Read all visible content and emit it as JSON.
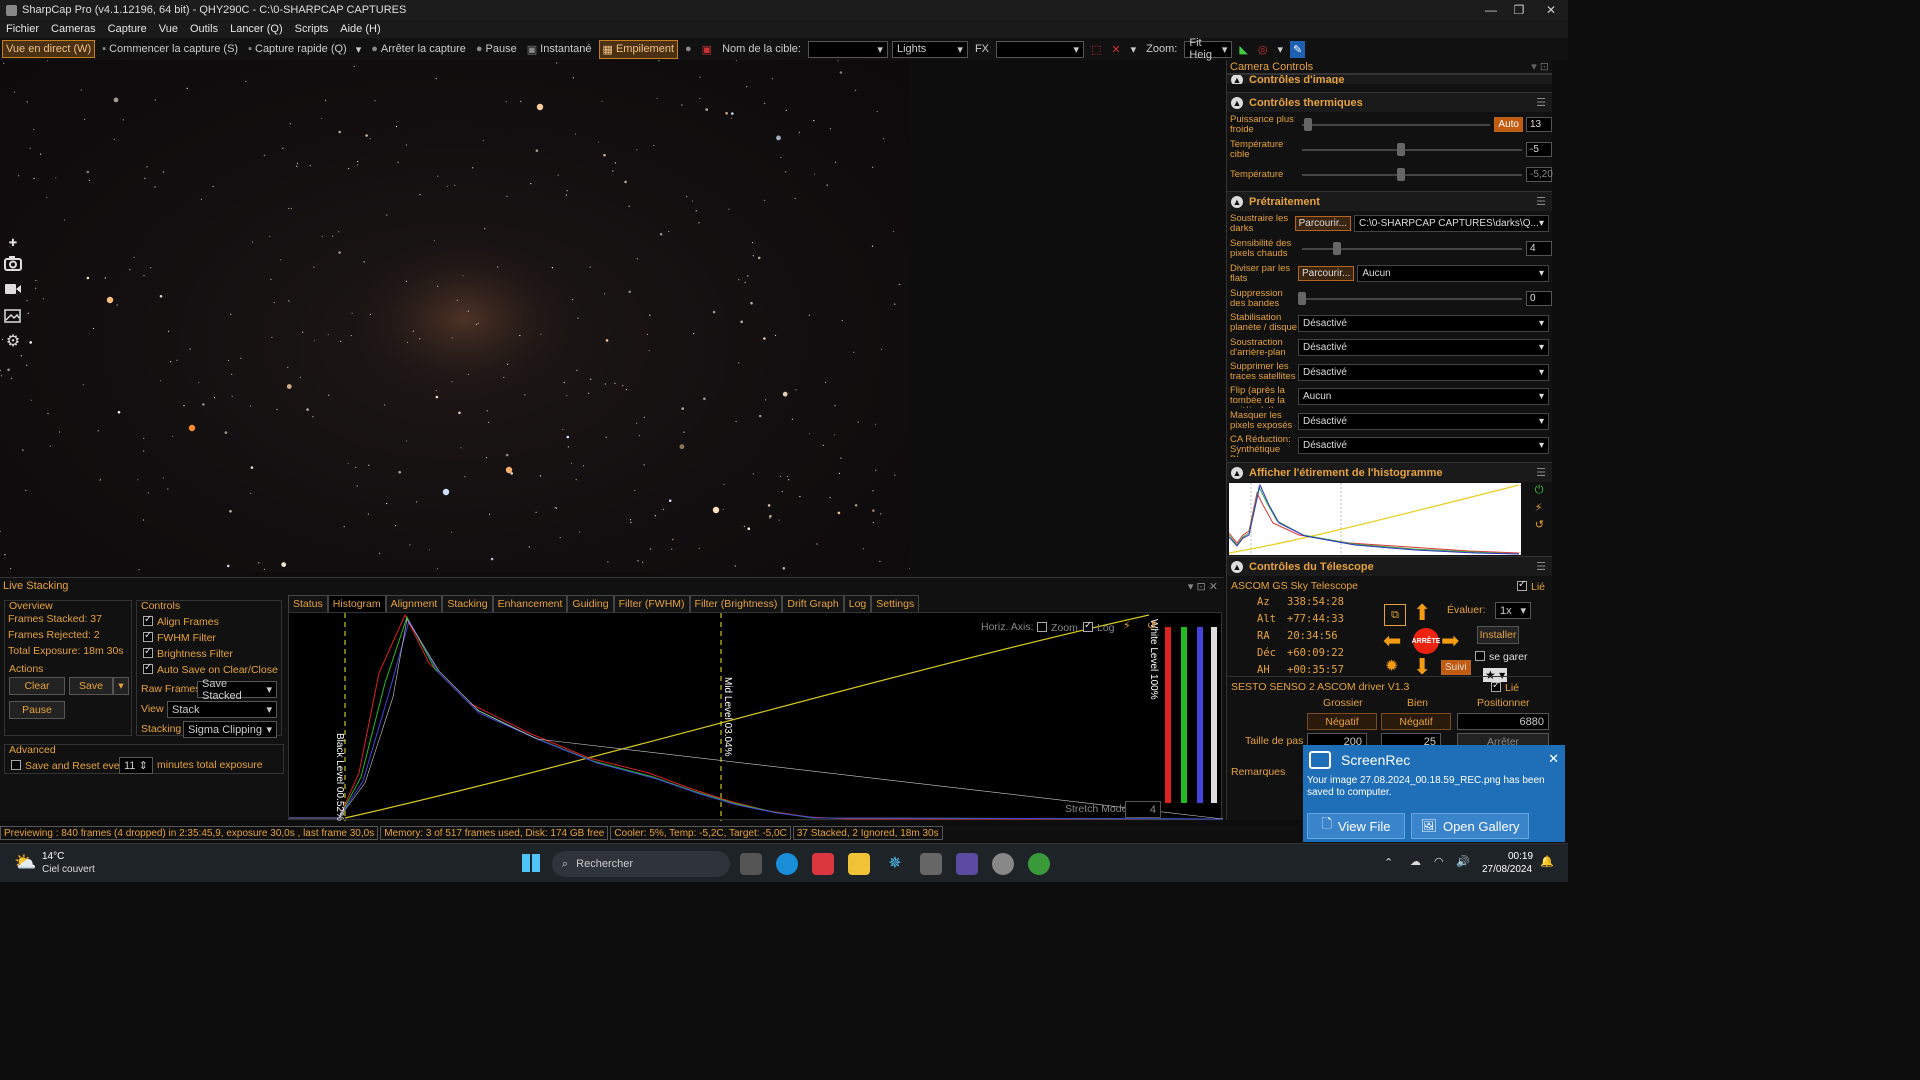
{
  "titlebar": {
    "title": "SharpCap Pro (v4.1.12196, 64 bit) - QHY290C - C:\\0-SHARPCAP CAPTURES"
  },
  "menu": [
    "Fichier",
    "Cameras",
    "Capture",
    "Vue",
    "Outils",
    "Lancer (Q)",
    "Scripts",
    "Aide (H)"
  ],
  "toolbar": {
    "live": "Vue en direct (W)",
    "start": "Commencer la capture (S)",
    "quick": "Capture rapide (Q)",
    "stop": "Arrêter la capture",
    "pause": "Pause",
    "snap": "Instantané",
    "stack": "Empilement",
    "target_label": "Nom de la cible:",
    "target_value": "",
    "frame_type": "Lights",
    "fx_label": "FX",
    "fx_value": "",
    "zoom_label": "Zoom:",
    "zoom_value": "Fit Heig"
  },
  "camera_controls": {
    "title": "Camera Controls",
    "prev_section": "Contrôles d'image",
    "thermal": {
      "title": "Contrôles thermiques",
      "power_label": "Puissance plus froide",
      "power_auto": "Auto",
      "power_value": "13",
      "power_level": 0.03,
      "target_label": "Température cible",
      "target_value": "-5",
      "target_level": 0.45,
      "temp_label": "Température",
      "temp_value": "-5,20",
      "temp_level": 0.45
    },
    "preproc": {
      "title": "Prétraitement",
      "darks_label": "Soustraire les darks",
      "browse": "Parcourir...",
      "darks_value": "C:\\0-SHARPCAP CAPTURES\\darks\\Q...",
      "hot_label": "Sensibilité des pixels chauds",
      "hot_value": "4",
      "hot_level": 0.16,
      "flats_label": "Diviser par les flats",
      "flats_value": "Aucun",
      "banding_label": "Suppression des bandes",
      "banding_value": "0",
      "banding_level": 0.0,
      "stab_label": "Stabilisation planète / disque",
      "stab_value": "Désactivé",
      "bg_label": "Soustraction d'arrière-plan",
      "bg_value": "Désactivé",
      "sat_label": "Supprimer les traces satellites",
      "sat_value": "Désactivé",
      "flip_label": "Flip (après la tombée de la nuit/à plat)",
      "flip_value": "Aucun",
      "mask_label": "Masquer les pixels exposés",
      "mask_value": "Désactivé",
      "ca_label": "CA Réduction: Synthétique Bleu",
      "ca_value": "Désactivé"
    },
    "histo_section": {
      "title": "Afficher l'étirement de l'histogramme"
    },
    "telescope": {
      "title": "Contrôles du Télescope",
      "driver": "ASCOM GS Sky Telescope",
      "linked": "Lié",
      "az_label": "Az",
      "az": "338:54:28",
      "alt_label": "Alt",
      "alt": "+77:44:33",
      "ra_label": "RA",
      "ra": "20:34:56",
      "dec_label": "Déc",
      "dec": "+60:09:22",
      "ah_label": "AH",
      "ah": "+00:35:57",
      "rate_label": "Évaluer:",
      "rate": "1x",
      "install": "Installer",
      "park": "se garer",
      "stop": "ARRÊTE",
      "track": "Suivi"
    },
    "focuser": {
      "driver": "SESTO SENSO 2 ASCOM driver V1.3",
      "linked": "Lié",
      "coarse": "Grossier",
      "fine": "Bien",
      "position": "Positionner",
      "neg1": "Négatif",
      "neg2": "Négatif",
      "pos_value": "6880",
      "step_label": "Taille de pas",
      "step1": "200",
      "step2": "25",
      "stop": "Arrêter",
      "remarks": "Remarques"
    }
  },
  "live_stacking": {
    "title": "Live Stacking",
    "overview": {
      "title": "Overview",
      "stacked": "Frames Stacked:  37",
      "rejected": "Frames Rejected: 2",
      "exposure": "Total Exposure:    18m 30s"
    },
    "actions": {
      "title": "Actions",
      "clear": "Clear",
      "save": "Save",
      "pause": "Pause"
    },
    "controls": {
      "title": "Controls",
      "align": "Align Frames",
      "fwhm": "FWHM Filter",
      "bright": "Brightness Filter",
      "autosave": "Auto Save on Clear/Close",
      "raw_label": "Raw Frames",
      "raw_value": "Save Stacked",
      "view_label": "View",
      "view_value": "Stack",
      "stacking_label": "Stacking",
      "stacking_value": "Sigma Clipping"
    },
    "advanced": {
      "title": "Advanced",
      "label": "Save and Reset every",
      "value": "11",
      "suffix": "minutes total exposure"
    },
    "tabs": [
      "Status",
      "Histogram",
      "Alignment",
      "Stacking",
      "Enhancement",
      "Guiding",
      "Filter (FWHM)",
      "Filter (Brightness)",
      "Drift Graph",
      "Log",
      "Settings"
    ],
    "histogram": {
      "horiz_axis": "Horiz. Axis:",
      "zoom": "Zoom",
      "log": "Log",
      "black": "Black Level  00.52%",
      "mid": "Mid Level  03.04%",
      "white": "White Level  100%",
      "stretch": "Stretch Mode",
      "stretch_value": "4"
    }
  },
  "status": [
    "Previewing : 840 frames (4 dropped) in 2:35:45,9, exposure 30,0s , last frame 30,0s",
    "Memory: 3 of 517 frames used, Disk: 174 GB free",
    "Cooler: 5%, Temp: -5,2C, Target: -5,0C",
    "37 Stacked, 2 Ignored, 18m 30s"
  ],
  "toast": {
    "app": "ScreenRec",
    "message": "Your image 27.08.2024_00.18.59_REC.png has been saved to computer.",
    "view": "View File",
    "gallery": "Open Gallery"
  },
  "taskbar": {
    "temp": "14°C",
    "weather": "Ciel couvert",
    "search": "Rechercher",
    "time": "00:19",
    "date": "27/08/2024"
  }
}
